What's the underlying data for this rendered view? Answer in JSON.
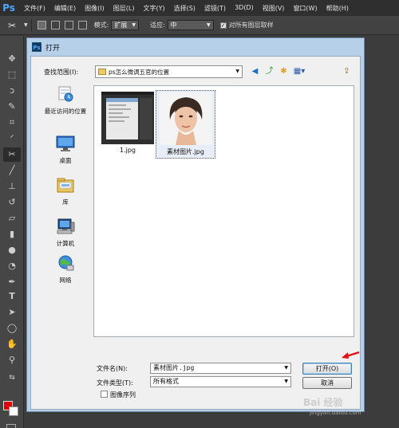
{
  "app": {
    "logo": "Ps"
  },
  "menubar": {
    "items": [
      "文件(F)",
      "编辑(E)",
      "图像(I)",
      "图层(L)",
      "文字(Y)",
      "选择(S)",
      "滤镜(T)",
      "3D(D)",
      "视图(V)",
      "窗口(W)",
      "帮助(H)"
    ]
  },
  "options": {
    "mode_label": "模式:",
    "mode_value": "扩展",
    "adapt_label": "适应:",
    "adapt_value": "中",
    "sample_all_checked": true,
    "sample_all_label": "对所有图层取样"
  },
  "toolbar": {
    "tools": [
      "move-tool",
      "marquee-tool",
      "lasso-tool",
      "quick-select-tool",
      "crop-tool",
      "eyedropper-tool",
      "content-aware-move-tool",
      "brush-tool",
      "clone-stamp-tool",
      "history-brush-tool",
      "eraser-tool",
      "gradient-tool",
      "blur-tool",
      "dodge-tool",
      "pen-tool",
      "type-tool",
      "path-select-tool",
      "shape-tool",
      "hand-tool",
      "zoom-tool"
    ],
    "fg_color": "#e00000",
    "bg_color": "#ffffff"
  },
  "dialog": {
    "title": "打开",
    "look_in_label": "查找范围(I):",
    "look_in_value": "ps怎么微调五官的位置",
    "places": [
      {
        "label": "最近访问的位置",
        "icon": "recent-places-icon"
      },
      {
        "label": "桌面",
        "icon": "desktop-icon"
      },
      {
        "label": "库",
        "icon": "libraries-icon"
      },
      {
        "label": "计算机",
        "icon": "computer-icon"
      },
      {
        "label": "网络",
        "icon": "network-icon"
      }
    ],
    "files": [
      {
        "name": "1.jpg",
        "selected": false
      },
      {
        "name": "素材图片.jpg",
        "selected": true
      }
    ],
    "filename_label": "文件名(N):",
    "filename_value": "素材图片.jpg",
    "filetype_label": "文件类型(T):",
    "filetype_value": "所有格式",
    "open_button": "打开(O)",
    "cancel_button": "取消",
    "image_sequence_label": "图像序列",
    "image_sequence_checked": false
  },
  "watermark": {
    "text": "Bai 经验",
    "url": "jingyan.baidu.com"
  }
}
